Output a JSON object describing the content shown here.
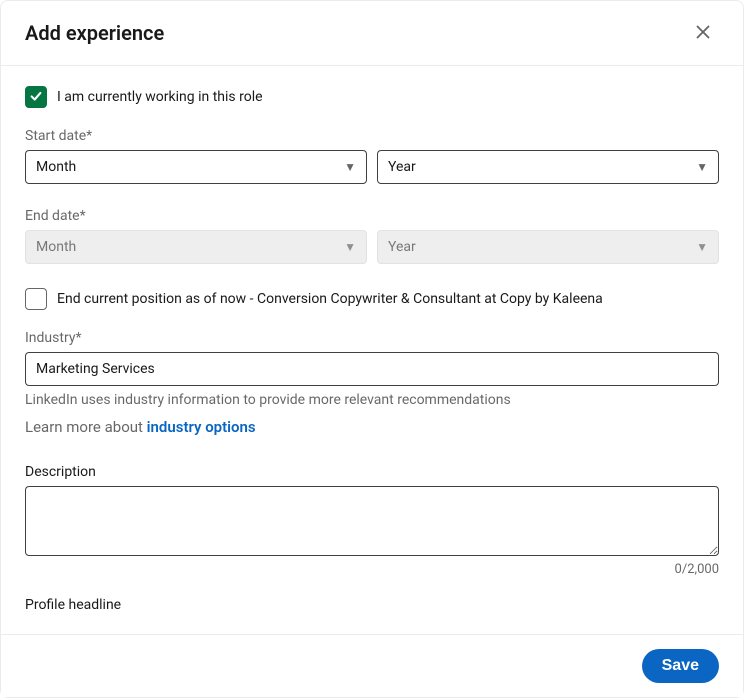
{
  "header": {
    "title": "Add experience"
  },
  "currentRole": {
    "checked": true,
    "label": "I am currently working in this role"
  },
  "startDate": {
    "label": "Start date*",
    "month": "Month",
    "year": "Year"
  },
  "endDate": {
    "label": "End date*",
    "month": "Month",
    "year": "Year"
  },
  "endCurrent": {
    "checked": false,
    "label": "End current position as of now - Conversion Copywriter & Consultant at Copy by Kaleena"
  },
  "industry": {
    "label": "Industry*",
    "value": "Marketing Services",
    "helper": "LinkedIn uses industry information to provide more relevant recommendations",
    "learnPrefix": "Learn more about ",
    "learnLink": "industry options"
  },
  "description": {
    "label": "Description",
    "value": "",
    "counter": "0/2,000"
  },
  "profileHeadline": {
    "label": "Profile headline"
  },
  "footer": {
    "save": "Save"
  }
}
